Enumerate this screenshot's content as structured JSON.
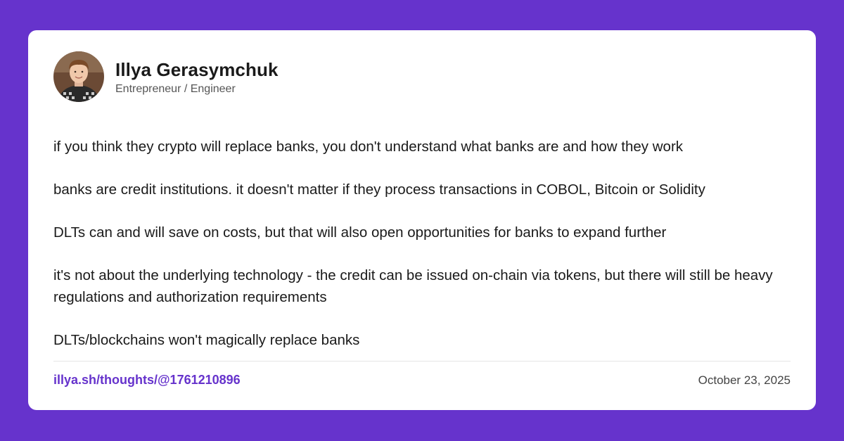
{
  "colors": {
    "background": "#6633cc",
    "card": "#ffffff",
    "link": "#6633cc",
    "text": "#1a1a1a"
  },
  "author": {
    "name": "Illya Gerasymchuk",
    "role": "Entrepreneur / Engineer",
    "avatar_icon": "profile-photo"
  },
  "post": {
    "paragraphs": [
      "if you think they crypto will replace banks, you don't understand what banks are and how they work",
      "banks are credit institutions. it doesn't matter if they process transactions in COBOL, Bitcoin or Solidity",
      "DLTs can and will save on costs, but that will also open opportunities for banks to expand further",
      "it's not about the underlying technology - the credit can be issued on-chain via tokens, but there will still be heavy regulations and authorization requirements",
      "DLTs/blockchains won't magically replace banks"
    ]
  },
  "footer": {
    "link_text": "illya.sh/thoughts/@1761210896",
    "date": "October 23, 2025"
  }
}
